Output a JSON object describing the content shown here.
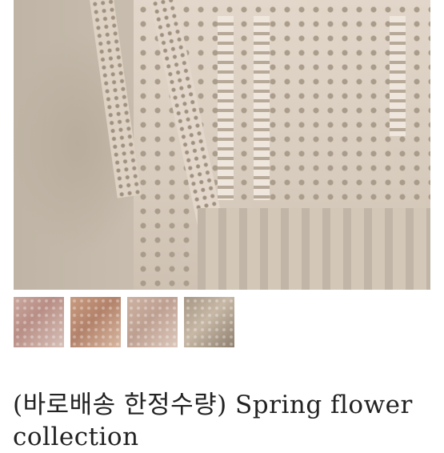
{
  "product": {
    "title": "(바로배송 한정수량) Spring flower collection"
  },
  "gallery": {
    "main_image": "lace-dress-photo",
    "thumbnail_count": 4
  }
}
